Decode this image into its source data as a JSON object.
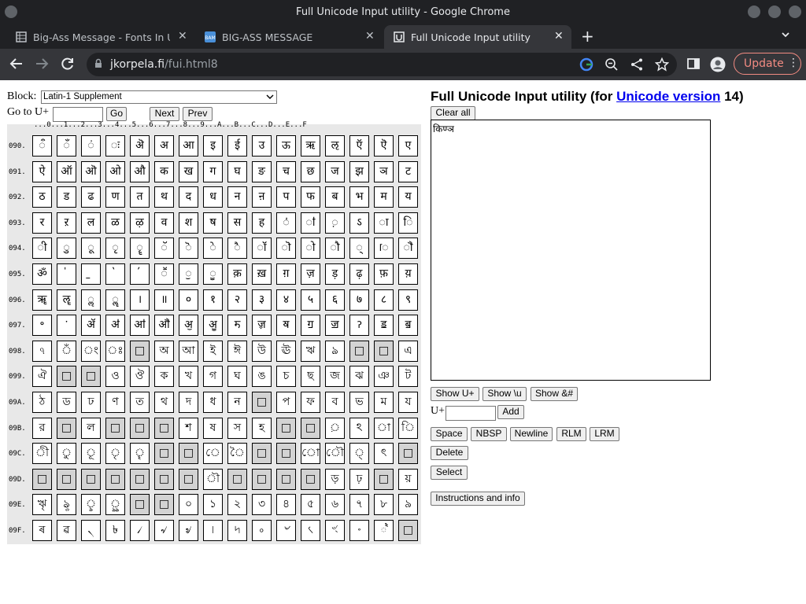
{
  "window": {
    "title": "Full Unicode Input utility - Google Chrome"
  },
  "tabs": [
    {
      "label": "Big-Ass Message - Fonts In Us",
      "active": false
    },
    {
      "label": "BIG-ASS MESSAGE",
      "active": false
    },
    {
      "label": "Full Unicode Input utility",
      "active": true
    }
  ],
  "toolbar": {
    "url_host": "jkorpela.fi",
    "url_path": "/fui.html8",
    "update_label": "Update"
  },
  "page": {
    "title_prefix": "Full Unicode Input utility (for ",
    "title_link": "Unicode version",
    "title_suffix": " 14)",
    "block_label": "Block:",
    "block_value": "Latin-1 Supplement",
    "goto_label": "Go to U+",
    "go_button": "Go",
    "next_button": "Next",
    "prev_button": "Prev",
    "clear_all": "Clear all",
    "textarea_value": "किण्ञ",
    "show_u": "Show U+",
    "show_backslash_u": "Show \\u",
    "show_amp": "Show &#",
    "uplus_label": "U+",
    "add_button": "Add",
    "space": "Space",
    "nbsp": "NBSP",
    "newline": "Newline",
    "rlm": "RLM",
    "lrm": "LRM",
    "delete": "Delete",
    "select": "Select",
    "instructions": "Instructions and info"
  },
  "grid": {
    "header": "...0...1...2...3...4...5...6...7...8...9...A...B...C...D...E...F",
    "rows": [
      {
        "label": "090.",
        "cells": [
          "ऀ",
          "ँ",
          "ं",
          "ः",
          "ऄ",
          "अ",
          "आ",
          "इ",
          "ई",
          "उ",
          "ऊ",
          "ऋ",
          "ऌ",
          "ऍ",
          "ऎ",
          "ए"
        ]
      },
      {
        "label": "091.",
        "cells": [
          "ऐ",
          "ऑ",
          "ऒ",
          "ओ",
          "औ",
          "क",
          "ख",
          "ग",
          "घ",
          "ङ",
          "च",
          "छ",
          "ज",
          "झ",
          "ञ",
          "ट"
        ]
      },
      {
        "label": "092.",
        "cells": [
          "ठ",
          "ड",
          "ढ",
          "ण",
          "त",
          "थ",
          "द",
          "ध",
          "न",
          "ऩ",
          "प",
          "फ",
          "ब",
          "भ",
          "म",
          "य"
        ]
      },
      {
        "label": "093.",
        "cells": [
          "र",
          "ऱ",
          "ल",
          "ळ",
          "ऴ",
          "व",
          "श",
          "ष",
          "स",
          "ह",
          "ऺ",
          "ऻ",
          "़",
          "ऽ",
          "ा",
          "ि"
        ]
      },
      {
        "label": "094.",
        "cells": [
          "ी",
          "ु",
          "ू",
          "ृ",
          "ॄ",
          "ॅ",
          "ॆ",
          "े",
          "ै",
          "ॉ",
          "ॊ",
          "ो",
          "ौ",
          "्",
          "ॎ",
          "ॏ"
        ]
      },
      {
        "label": "095.",
        "cells": [
          "ॐ",
          "॑",
          "॒",
          "॓",
          "॔",
          "ॕ",
          "ॖ",
          "ॗ",
          "क़",
          "ख़",
          "ग़",
          "ज़",
          "ड़",
          "ढ़",
          "फ़",
          "य़"
        ]
      },
      {
        "label": "096.",
        "cells": [
          "ॠ",
          "ॡ",
          "ॢ",
          "ॣ",
          "।",
          "॥",
          "०",
          "१",
          "२",
          "३",
          "४",
          "५",
          "६",
          "७",
          "८",
          "९"
        ]
      },
      {
        "label": "097.",
        "cells": [
          "॰",
          "ॱ",
          "ॲ",
          "ॳ",
          "ॴ",
          "ॵ",
          "ॶ",
          "ॷ",
          "ॸ",
          "ॹ",
          "ॺ",
          "ॻ",
          "ॼ",
          "ॽ",
          "ॾ",
          "ॿ"
        ]
      },
      {
        "label": "098.",
        "cells": [
          "ঀ",
          "ঁ",
          "ং",
          "ঃ",
          "□",
          "অ",
          "আ",
          "ই",
          "ঈ",
          "উ",
          "ঊ",
          "ঋ",
          "ঌ",
          "□",
          "□",
          "এ"
        ],
        "gray": [
          4,
          13,
          14
        ]
      },
      {
        "label": "099.",
        "cells": [
          "ঐ",
          "□",
          "□",
          "ও",
          "ঔ",
          "ক",
          "খ",
          "গ",
          "ঘ",
          "ঙ",
          "চ",
          "ছ",
          "জ",
          "ঝ",
          "ঞ",
          "ট"
        ],
        "gray": [
          1,
          2
        ]
      },
      {
        "label": "09A.",
        "cells": [
          "ঠ",
          "ড",
          "ঢ",
          "ণ",
          "ত",
          "থ",
          "দ",
          "ধ",
          "ন",
          "□",
          "প",
          "ফ",
          "ব",
          "ভ",
          "ম",
          "য"
        ],
        "gray": [
          9
        ]
      },
      {
        "label": "09B.",
        "cells": [
          "র",
          "□",
          "ল",
          "□",
          "□",
          "□",
          "শ",
          "ষ",
          "স",
          "হ",
          "□",
          "□",
          "়",
          "ঽ",
          "া",
          "ি"
        ],
        "gray": [
          1,
          3,
          4,
          5,
          10,
          11
        ]
      },
      {
        "label": "09C.",
        "cells": [
          "ী",
          "ু",
          "ূ",
          "ৃ",
          "ৄ",
          "□",
          "□",
          "ে",
          "ৈ",
          "□",
          "□",
          "ো",
          "ৌ",
          "্",
          "ৎ",
          "□"
        ],
        "gray": [
          5,
          6,
          9,
          10,
          15
        ]
      },
      {
        "label": "09D.",
        "cells": [
          "□",
          "□",
          "□",
          "□",
          "□",
          "□",
          "□",
          "ৗ",
          "□",
          "□",
          "□",
          "□",
          "ড়",
          "ঢ়",
          "□",
          "য়"
        ],
        "gray": [
          0,
          1,
          2,
          3,
          4,
          5,
          6,
          8,
          9,
          10,
          11,
          14
        ]
      },
      {
        "label": "09E.",
        "cells": [
          "ৠ",
          "ৡ",
          "ৢ",
          "ৣ",
          "□",
          "□",
          "০",
          "১",
          "২",
          "৩",
          "৪",
          "৫",
          "৬",
          "৭",
          "৮",
          "৯"
        ],
        "gray": [
          4,
          5
        ]
      },
      {
        "label": "09F.",
        "cells": [
          "ৰ",
          "ৱ",
          "৲",
          "৳",
          "৴",
          "৵",
          "৶",
          "৷",
          "৸",
          "৹",
          "৺",
          "৻",
          "ৼ",
          "৽",
          "৾",
          "□"
        ],
        "gray": [
          15
        ]
      }
    ]
  }
}
